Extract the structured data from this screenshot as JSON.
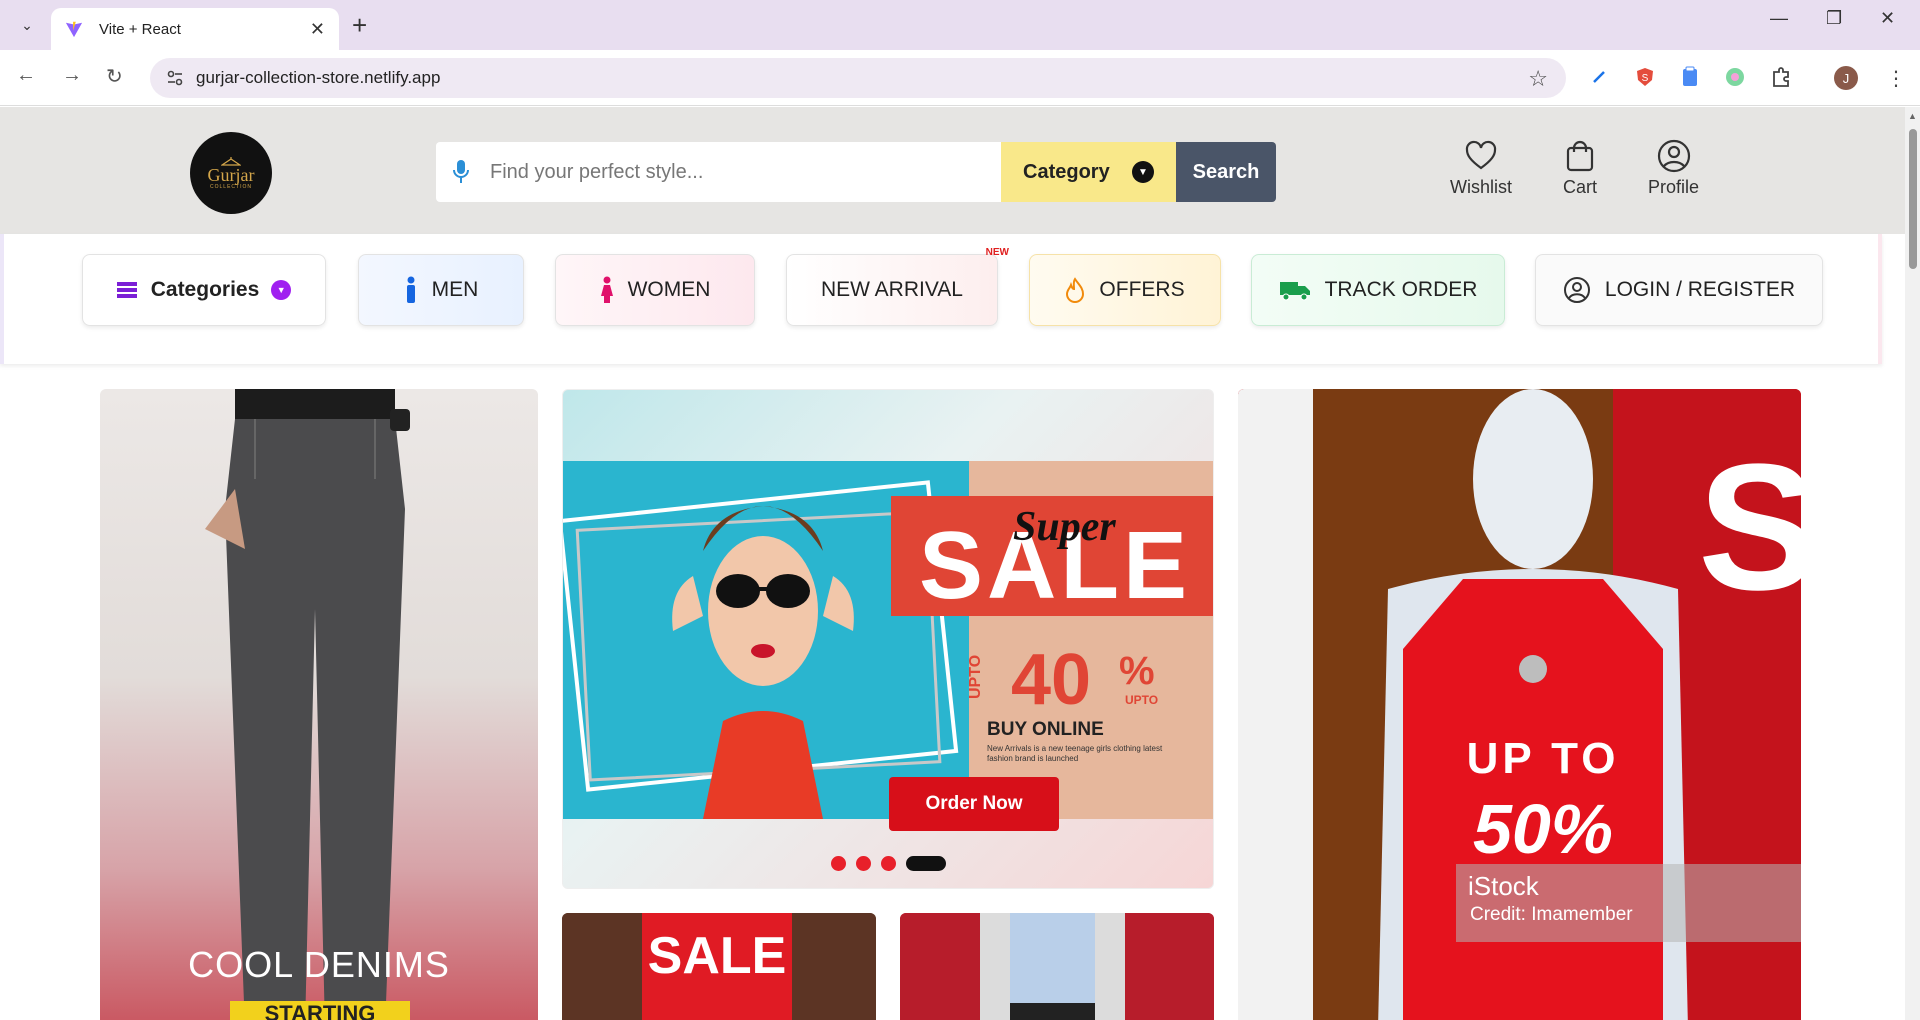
{
  "browser": {
    "tab_title": "Vite + React",
    "url": "gurjar-collection-store.netlify.app",
    "profile_initial": "J"
  },
  "header": {
    "logo_name": "Gurjar",
    "logo_sub": "COLLECTION",
    "search_placeholder": "Find your perfect style...",
    "category_label": "Category",
    "search_label": "Search",
    "wishlist_label": "Wishlist",
    "cart_label": "Cart",
    "profile_label": "Profile"
  },
  "nav": {
    "categories": "Categories",
    "men": "MEN",
    "women": "WOMEN",
    "new_arrival": "NEW ARRIVAL",
    "new_badge": "NEW",
    "offers": "OFFERS",
    "track_order": "TRACK ORDER",
    "login": "LOGIN / REGISTER"
  },
  "banners": {
    "denims_title": "COOL DENIMS",
    "denims_strip": "STARTING",
    "super": "Super",
    "sale": "SALE",
    "upto": "UPTO",
    "percent": "40",
    "percent_sign": "%",
    "upto_small": "UPTO",
    "buy_online": "BUY ONLINE",
    "buy_sub": "New Arrivals is a new teenage girls clothing latest fashion brand is launched",
    "order_now": "Order Now",
    "thumb_sale": "SALE",
    "tag_upto": "UP TO",
    "tag_pct": "50%",
    "istock_brand": "iStock",
    "istock_credit": "Credit: Imamember"
  },
  "colors": {
    "accent_purple": "#7b1fd6",
    "sale_red": "#d70f19",
    "category_yellow": "#f9e88a"
  }
}
